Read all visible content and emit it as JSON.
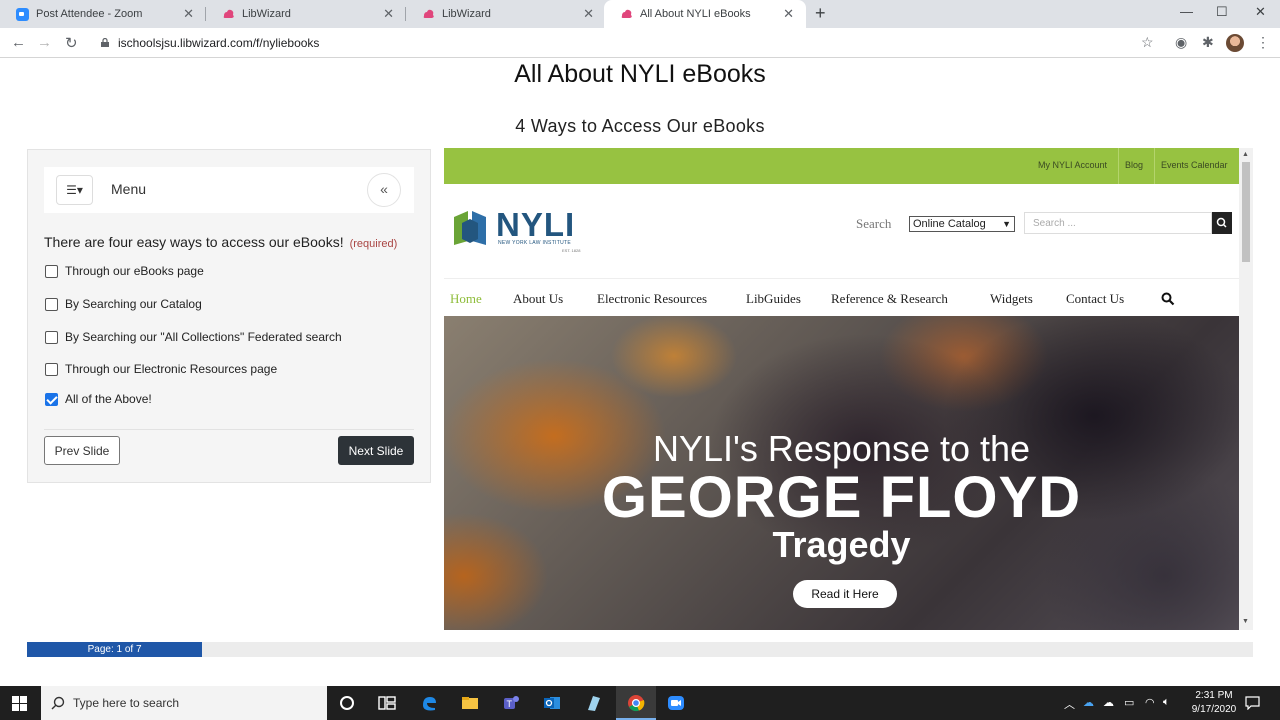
{
  "browser": {
    "tabs": [
      {
        "title": "Post Attendee - Zoom",
        "close": "✕"
      },
      {
        "title": "LibWizard",
        "close": "✕"
      },
      {
        "title": "LibWizard",
        "close": "✕"
      },
      {
        "title": "All About NYLI eBooks",
        "close": "✕"
      }
    ],
    "new_tab": "+",
    "url": "ischoolsjsu.libwizard.com/f/nyliebooks",
    "window_controls": [
      "—",
      "☐",
      "✕"
    ]
  },
  "page": {
    "title": "All About NYLI eBooks",
    "subtitle": "4 Ways to Access Our eBooks"
  },
  "quiz": {
    "menu_label": "Menu",
    "collapse_icon": "«",
    "question": "There are four easy ways to access our eBooks!",
    "required": "(required)",
    "options": [
      {
        "label": "Through our eBooks page",
        "checked": false
      },
      {
        "label": "By Searching our Catalog",
        "checked": false
      },
      {
        "label": "By Searching our \"All Collections\" Federated search",
        "checked": false
      },
      {
        "label": "Through our Electronic Resources page",
        "checked": false
      },
      {
        "label": "All of the Above!",
        "checked": true
      }
    ],
    "prev_label": "Prev Slide",
    "next_label": "Next Slide"
  },
  "nyli": {
    "top_links": [
      "My NYLI Account",
      "Blog",
      "Events Calendar"
    ],
    "logo_text": "NYLI",
    "logo_subtext": "NEW YORK LAW INSTITUTE",
    "logo_est": "EST. 1828",
    "search_label": "Search",
    "catalog_select": "Online Catalog",
    "search_placeholder": "Search ...",
    "nav": [
      "Home",
      "About Us",
      "Electronic Resources",
      "LibGuides",
      "Reference & Research",
      "Widgets",
      "Contact Us"
    ],
    "hero_line1": "NYLI's Response to the",
    "hero_line2": "GEORGE FLOYD",
    "hero_line3": "Tragedy",
    "hero_button": "Read it Here",
    "accent": "#97c241"
  },
  "progress": {
    "label": "Page: 1 of 7",
    "current": 1,
    "total": 7
  },
  "taskbar": {
    "search_placeholder": "Type here to search",
    "time": "2:31 PM",
    "date": "9/17/2020"
  }
}
